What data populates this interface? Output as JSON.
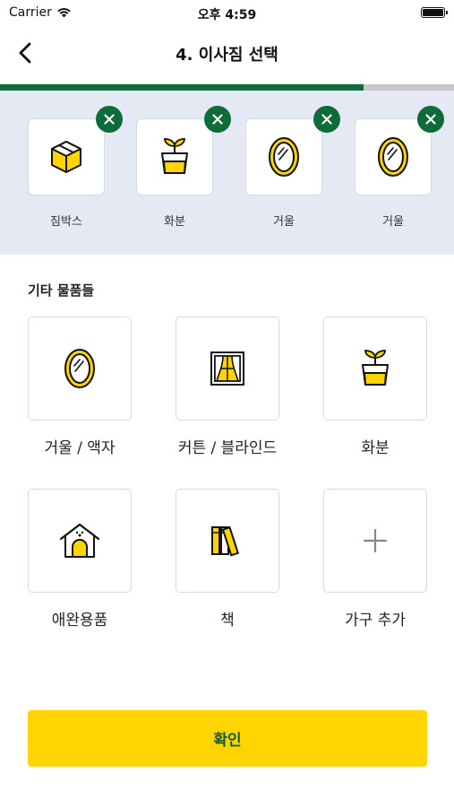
{
  "status_bar": {
    "carrier": "Carrier",
    "time": "오후 4:59"
  },
  "header": {
    "title": "4. 이사짐 선택"
  },
  "progress": {
    "fraction": 0.8
  },
  "selected_items": [
    {
      "label": "짐박스",
      "icon": "box-icon"
    },
    {
      "label": "화분",
      "icon": "plant-icon"
    },
    {
      "label": "거울",
      "icon": "mirror-icon"
    },
    {
      "label": "거울",
      "icon": "mirror-icon"
    }
  ],
  "section": {
    "title": "기타 물품들"
  },
  "grid_items": [
    {
      "label": "거울 / 액자",
      "icon": "mirror-icon"
    },
    {
      "label": "커튼 / 블라인드",
      "icon": "curtain-icon"
    },
    {
      "label": "화분",
      "icon": "plant-icon"
    },
    {
      "label": "애완용품",
      "icon": "pet-house-icon"
    },
    {
      "label": "책",
      "icon": "books-icon"
    },
    {
      "label": "가구 추가",
      "icon": "plus-icon"
    }
  ],
  "confirm": {
    "label": "확인"
  },
  "colors": {
    "accent_green": "#0e6b3a",
    "accent_yellow": "#ffd400",
    "strip_bg": "#e5e9f4"
  }
}
